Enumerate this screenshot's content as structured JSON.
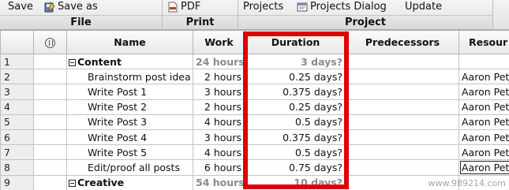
{
  "ribbon": {
    "file": {
      "save": "Save",
      "save_as": "Save as",
      "label": "File"
    },
    "print": {
      "pdf": "PDF",
      "label": "Print"
    },
    "project": {
      "projects": "Projects",
      "projects_dialog": "Projects Dialog",
      "update": "Update",
      "label": "Project"
    }
  },
  "grid": {
    "columns": {
      "name": "Name",
      "work": "Work",
      "duration": "Duration",
      "predecessors": "Predecessors",
      "resources": "Resour"
    },
    "rows": [
      {
        "num": "1",
        "name": "Content",
        "work": "24 hours",
        "duration": "3 days?",
        "resources": ""
      },
      {
        "num": "2",
        "name": "Brainstorm post idea",
        "work": "2 hours",
        "duration": "0.25 days?",
        "resources": "Aaron Pete"
      },
      {
        "num": "3",
        "name": "Write Post 1",
        "work": "3 hours",
        "duration": "0.375 days?",
        "resources": "Aaron Pete"
      },
      {
        "num": "4",
        "name": "Write Post 2",
        "work": "2 hours",
        "duration": "0.25 days?",
        "resources": "Aaron Pete"
      },
      {
        "num": "5",
        "name": "Write Post 3",
        "work": "4 hours",
        "duration": "0.5 days?",
        "resources": "Aaron Pete"
      },
      {
        "num": "6",
        "name": "Write Post 4",
        "work": "3 hours",
        "duration": "0.375 days?",
        "resources": "Aaron Pete"
      },
      {
        "num": "7",
        "name": "Write Post 5",
        "work": "4 hours",
        "duration": "0.5 days?",
        "resources": "Aaron Pete"
      },
      {
        "num": "8",
        "name": "Edit/proof all posts",
        "work": "6 hours",
        "duration": "0.75 days?",
        "resources": "Aaron Pete"
      },
      {
        "num": "9",
        "name": "Creative",
        "work": "54 hours",
        "duration": "10 days?",
        "resources": ""
      }
    ]
  },
  "watermark": "www.989214.com",
  "colors": {
    "highlight": "#e00000",
    "summary_text": "#8a8a8a"
  },
  "icons": {
    "save_as": "save-as-icon",
    "pdf": "pdf-icon",
    "projects_dialog": "projects-dialog-icon",
    "info": "info-icon",
    "collapse": "collapse-toggle-icon"
  }
}
